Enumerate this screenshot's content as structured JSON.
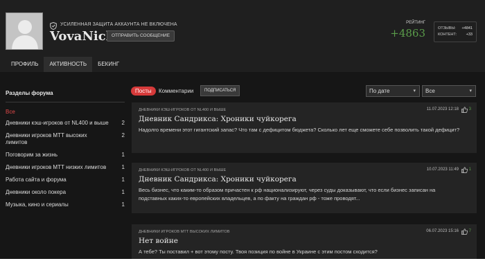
{
  "profile": {
    "security_notice": "УСИЛЕННАЯ ЗАЩИТА АККАУНТА НЕ ВКЛЮЧЕНА",
    "username": "VovaNich",
    "send_message_label": "ОТПРАВИТЬ СООБЩЕНИЕ",
    "rating_label": "РЕЙТИНГ",
    "rating_value": "+4863",
    "stats": {
      "reviews_label": "ОТЗЫВЫ:",
      "reviews_value": "+4841",
      "content_label": "КОНТЕНТ:",
      "content_value": "+33"
    }
  },
  "tabs": [
    {
      "label": "ПРОФИЛЬ"
    },
    {
      "label": "АКТИВНОСТЬ",
      "active": true
    },
    {
      "label": "БЕКИНГ"
    }
  ],
  "sidebar": {
    "title": "Разделы форума",
    "all_label": "Все",
    "items": [
      {
        "label": "Дневники кэш-игроков от NL400 и выше",
        "count": "2"
      },
      {
        "label": "Дневники игроков МТТ высоких лимитов",
        "count": "2"
      },
      {
        "label": "Поговорим за жизнь",
        "count": "1"
      },
      {
        "label": "Дневники игроков МТТ низких лимитов",
        "count": "1"
      },
      {
        "label": "Работа сайта и форума",
        "count": "1"
      },
      {
        "label": "Дневники около покера",
        "count": "1"
      },
      {
        "label": "Музыка, кино и сериалы",
        "count": "1"
      }
    ]
  },
  "filters": {
    "posts_label": "Посты",
    "comments_label": "Комментарии",
    "subscribe_label": "ПОДПИСАТЬСЯ",
    "sort_value": "По дате",
    "scope_value": "Все"
  },
  "posts": [
    {
      "category": "ДНЕВНИКИ КЭШ-ИГРОКОВ ОТ NL400 И ВЫШЕ",
      "date": "11.07.2023 12:18",
      "likes": "3",
      "title": "Дневник Сандрикса: Хроники чуйкорега",
      "text": "Надолго времени этот гигантский запас?  Что там с дефицитом бюджета? Сколько лет еще сможете себе позволить такой дефицит?"
    },
    {
      "category": "ДНЕВНИКИ КЭШ-ИГРОКОВ ОТ NL400 И ВЫШЕ",
      "date": "10.07.2023 11:49",
      "likes": "1",
      "title": "Дневник Сандрикса: Хроники чуйкорега",
      "text": "Весь бизнес, что каким-то образом причастен к рф национализируют, через суды доказывают, что если бизнес записан на подставных каких-то европейских владельцев, а по факту на граждан рф - тоже проводят..."
    },
    {
      "category": "ДНЕВНИКИ ИГРОКОВ МТТ ВЫСОКИХ ЛИМИТОВ",
      "date": "06.07.2023 15:16",
      "likes": "7",
      "title": "Нет войне",
      "text": "А тебе? Ты поставил + вот этому посту. Твоя позиция по войне в Украине с этим постом сходится?"
    }
  ],
  "colors": {
    "accent_red": "#d63a3a",
    "rating_green": "#5a9c4a",
    "header_bg": "#1f1f1f",
    "content_bg": "#161616",
    "card_bg": "#242424"
  },
  "icons": {
    "avatar": "default-avatar-silhouette",
    "security": "shield-icon",
    "like": "thumbs-up-icon",
    "select": "chevron-down-icon"
  }
}
